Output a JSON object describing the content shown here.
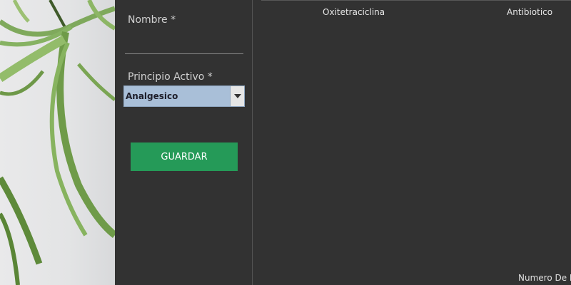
{
  "form": {
    "name_label": "Nombre  *",
    "name_value": "",
    "active_label": "Principio Activo *",
    "active_selected": "Analgesico",
    "save_label": "GUARDAR"
  },
  "table": {
    "rows": [
      {
        "name": "Oxitetraciclina",
        "type": "Antibiotico"
      }
    ]
  },
  "footer": {
    "label": "Numero De R"
  },
  "colors": {
    "background": "#323232",
    "save_button": "#259a58",
    "select_bg": "#a9bfd8"
  }
}
